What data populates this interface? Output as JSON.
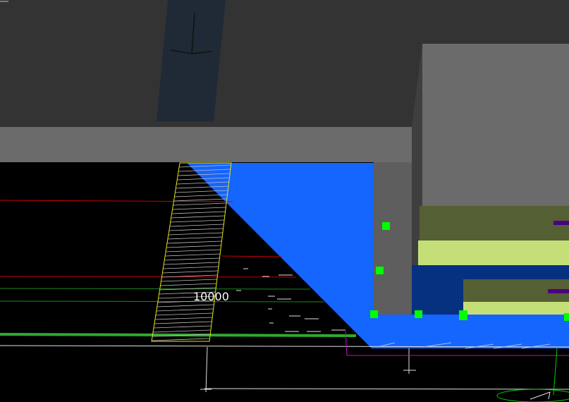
{
  "viewport": {
    "background": "#000000",
    "colors": {
      "wall_dark": "#333333",
      "wall_light": "#6b6b6b",
      "selection_blue": "#1565ff",
      "grip_green": "#00ff00",
      "hatch_yellow": "#e5e510",
      "olive": "#545f33",
      "light_green": "#c4df78",
      "navy": "#063080",
      "purple": "#4b0082",
      "magenta": "#c010c0"
    }
  },
  "annotations": {
    "dimension_value": "10000"
  },
  "grips": [
    {
      "name": "grip-1"
    },
    {
      "name": "grip-2"
    },
    {
      "name": "grip-3"
    },
    {
      "name": "grip-4"
    },
    {
      "name": "grip-5"
    },
    {
      "name": "grip-6"
    }
  ]
}
